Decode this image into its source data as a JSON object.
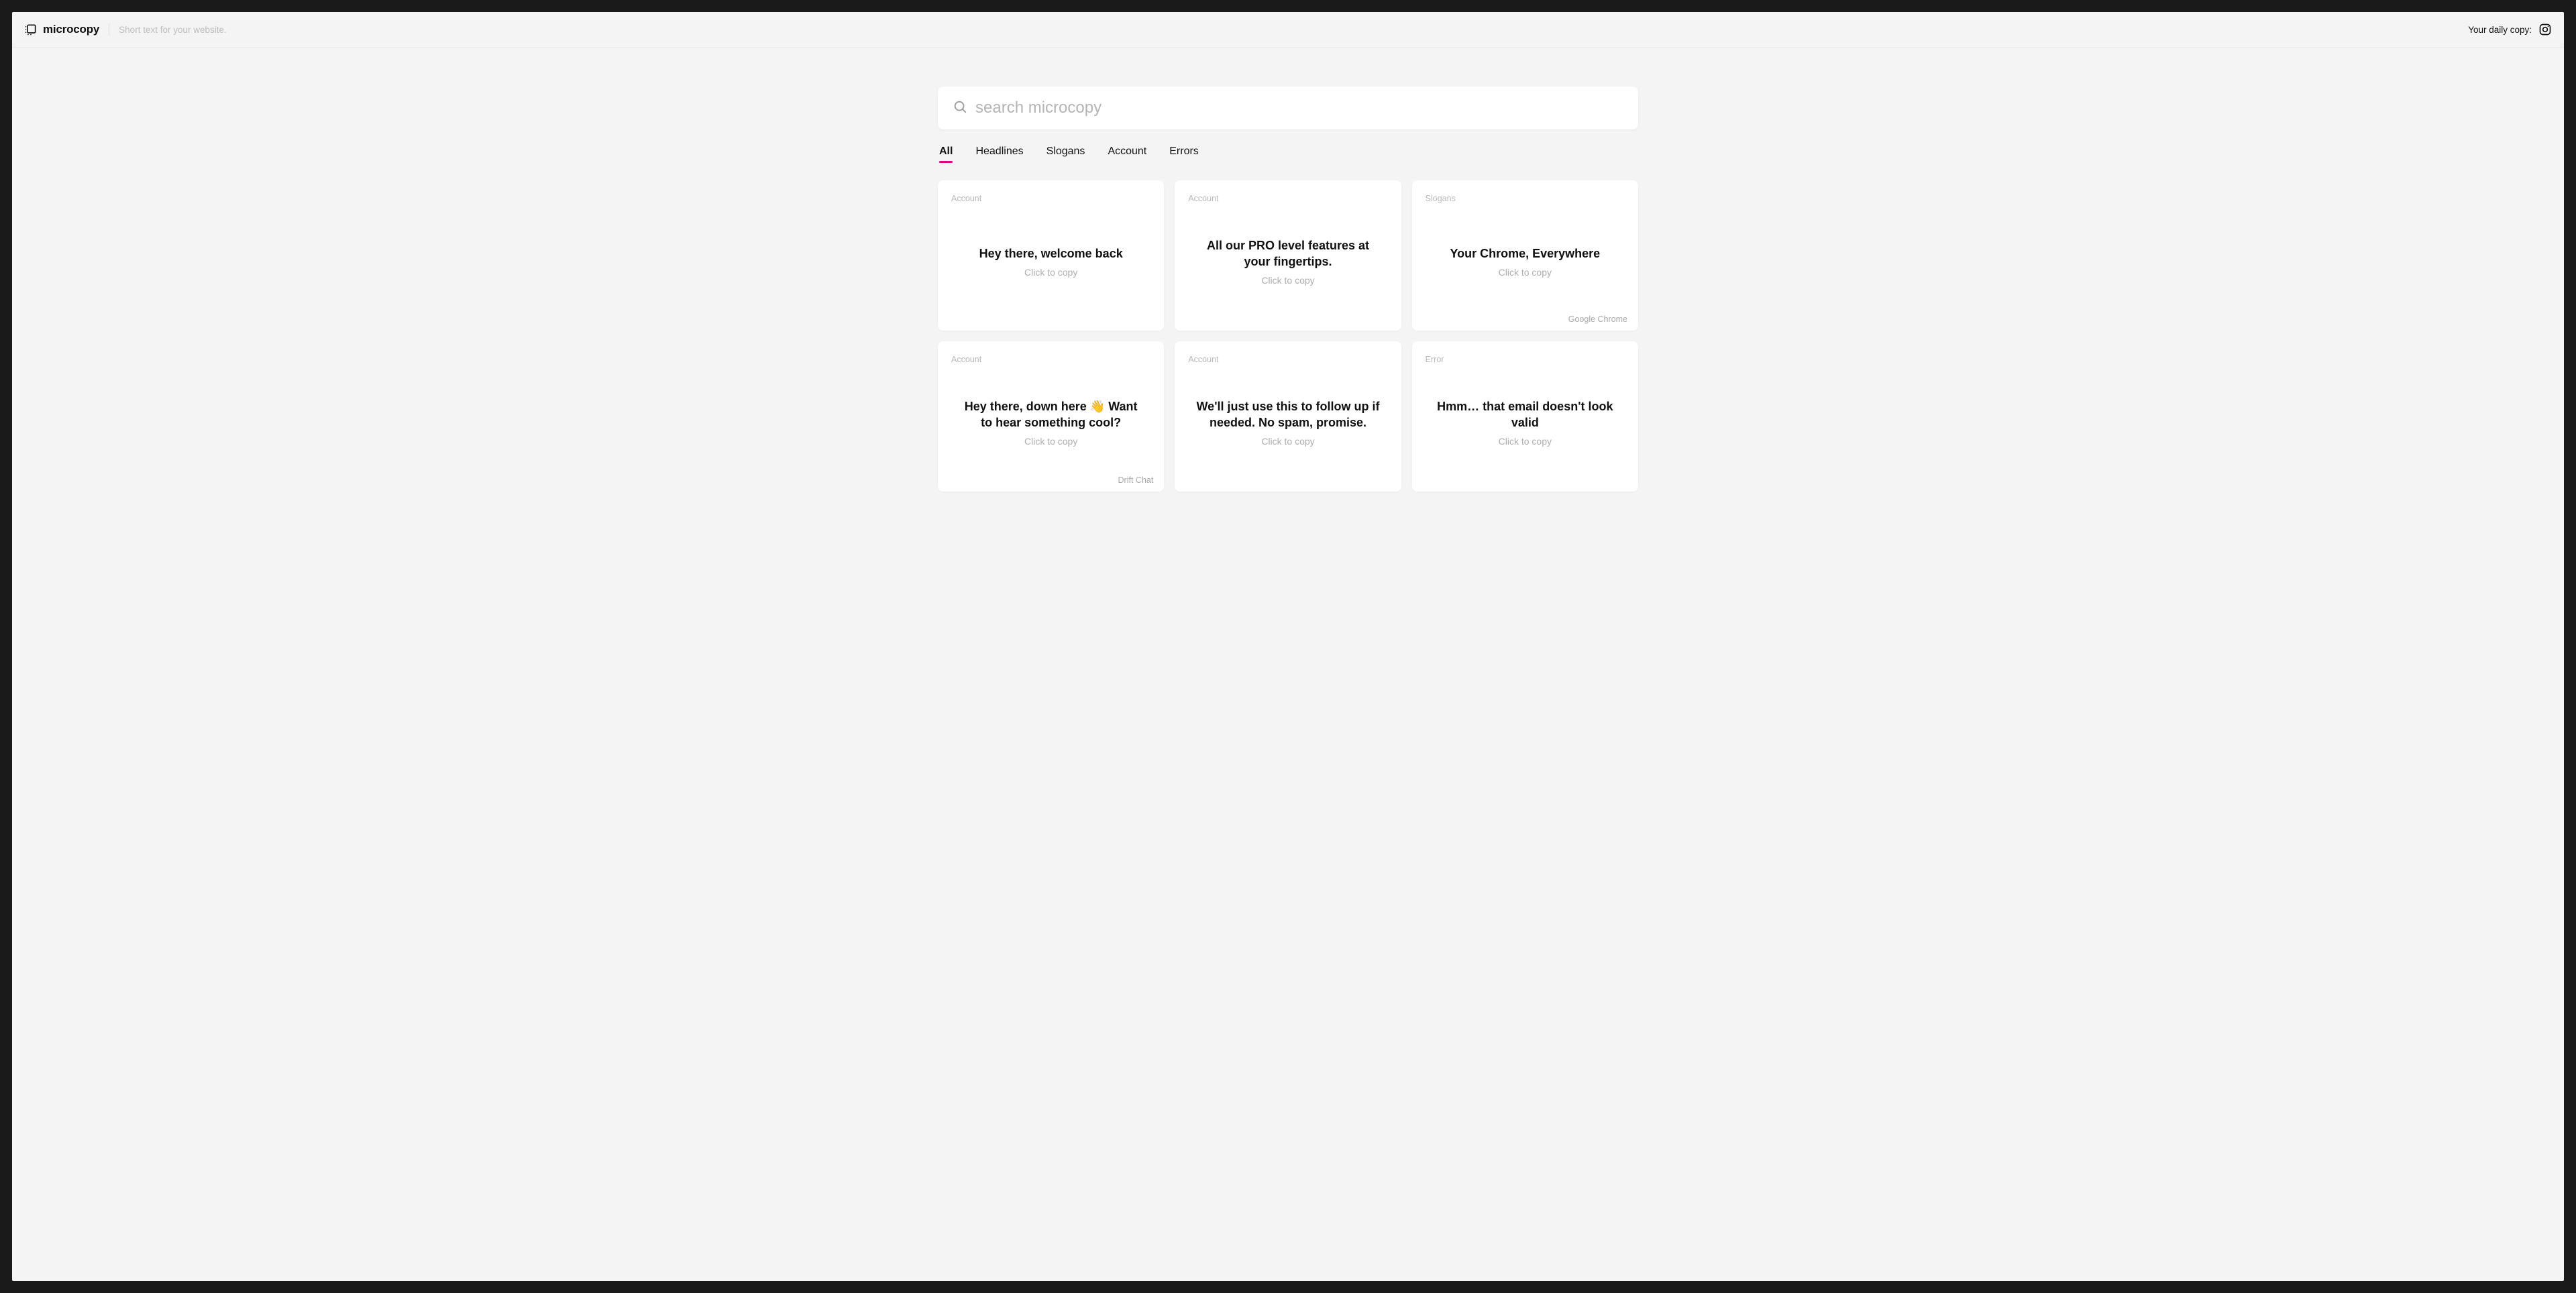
{
  "header": {
    "brand": "microcopy",
    "tagline": "Short text for your website.",
    "daily_label": "Your daily copy:"
  },
  "search": {
    "placeholder": "search microcopy"
  },
  "tabs": [
    {
      "label": "All",
      "active": true
    },
    {
      "label": "Headlines",
      "active": false
    },
    {
      "label": "Slogans",
      "active": false
    },
    {
      "label": "Account",
      "active": false
    },
    {
      "label": "Errors",
      "active": false
    }
  ],
  "copy_hint": "Click to copy",
  "cards": [
    {
      "category": "Account",
      "text": "Hey there, welcome back",
      "source": ""
    },
    {
      "category": "Account",
      "text": "All our PRO level features at your fingertips.",
      "source": ""
    },
    {
      "category": "Slogans",
      "text": "Your Chrome, Everywhere",
      "source": "Google Chrome"
    },
    {
      "category": "Account",
      "text": "Hey there, down here 👋 Want to hear something cool?",
      "source": "Drift Chat"
    },
    {
      "category": "Account",
      "text": "We'll just use this to follow up if needed. No spam, promise.",
      "source": ""
    },
    {
      "category": "Error",
      "text": "Hmm… that email doesn't look valid",
      "source": ""
    }
  ]
}
